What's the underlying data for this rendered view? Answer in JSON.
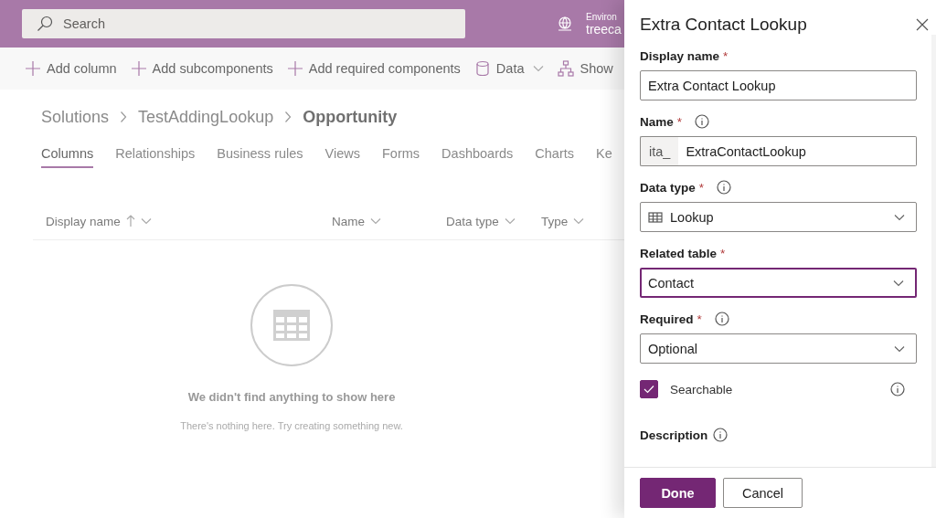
{
  "top_bar": {
    "search": {
      "placeholder": "Search"
    },
    "environment": {
      "label": "Environ",
      "name": "treeca"
    }
  },
  "command_bar": [
    {
      "label": "Add column",
      "kind": "add",
      "caret": false
    },
    {
      "label": "Add subcomponents",
      "kind": "add",
      "caret": false
    },
    {
      "label": "Add required components",
      "kind": "add",
      "caret": false
    },
    {
      "label": "Data",
      "kind": "data",
      "caret": true
    },
    {
      "label": "Show",
      "kind": "show",
      "caret": false
    }
  ],
  "breadcrumb": [
    {
      "label": "Solutions",
      "current": false
    },
    {
      "label": "TestAddingLookup",
      "current": false
    },
    {
      "label": "Opportunity",
      "current": true
    }
  ],
  "tabs": [
    {
      "label": "Columns",
      "selected": true
    },
    {
      "label": "Relationships",
      "selected": false
    },
    {
      "label": "Business rules",
      "selected": false
    },
    {
      "label": "Views",
      "selected": false
    },
    {
      "label": "Forms",
      "selected": false
    },
    {
      "label": "Dashboards",
      "selected": false
    },
    {
      "label": "Charts",
      "selected": false
    },
    {
      "label": "Ke",
      "selected": false
    }
  ],
  "table": {
    "columns": [
      {
        "label": "Display name",
        "sorted_ascending": true
      },
      {
        "label": "Name",
        "sorted_ascending": false
      },
      {
        "label": "Data type",
        "sorted_ascending": false
      },
      {
        "label": "Type",
        "sorted_ascending": false
      }
    ]
  },
  "empty_state": {
    "title": "We didn't find anything to show here",
    "message": "There's nothing here. Try creating something new."
  },
  "panel": {
    "title": "Extra Contact Lookup",
    "fields": [
      {
        "kind": "text",
        "label": "Display name",
        "required_mark": "*",
        "info": false,
        "value": "Extra Contact Lookup"
      },
      {
        "kind": "prefixed",
        "label": "Name",
        "required_mark": "*",
        "info": true,
        "prefix": "ita_",
        "value": "ExtraContactLookup"
      },
      {
        "kind": "type_dropdown",
        "label": "Data type",
        "required_mark": "*",
        "info": true,
        "value": "Lookup",
        "focused": false
      },
      {
        "kind": "dropdown",
        "label": "Related table",
        "required_mark": "*",
        "info": false,
        "value": "Contact",
        "focused": true
      },
      {
        "kind": "dropdown",
        "label": "Required",
        "required_mark": "*",
        "info": true,
        "value": "Optional",
        "focused": false
      },
      {
        "kind": "checkbox",
        "label": "Searchable",
        "checked": true,
        "info": true
      },
      {
        "kind": "heading",
        "label": "Description",
        "info": true
      }
    ],
    "buttons": [
      {
        "label": "Done",
        "primary": true
      },
      {
        "label": "Cancel",
        "primary": false
      }
    ]
  }
}
